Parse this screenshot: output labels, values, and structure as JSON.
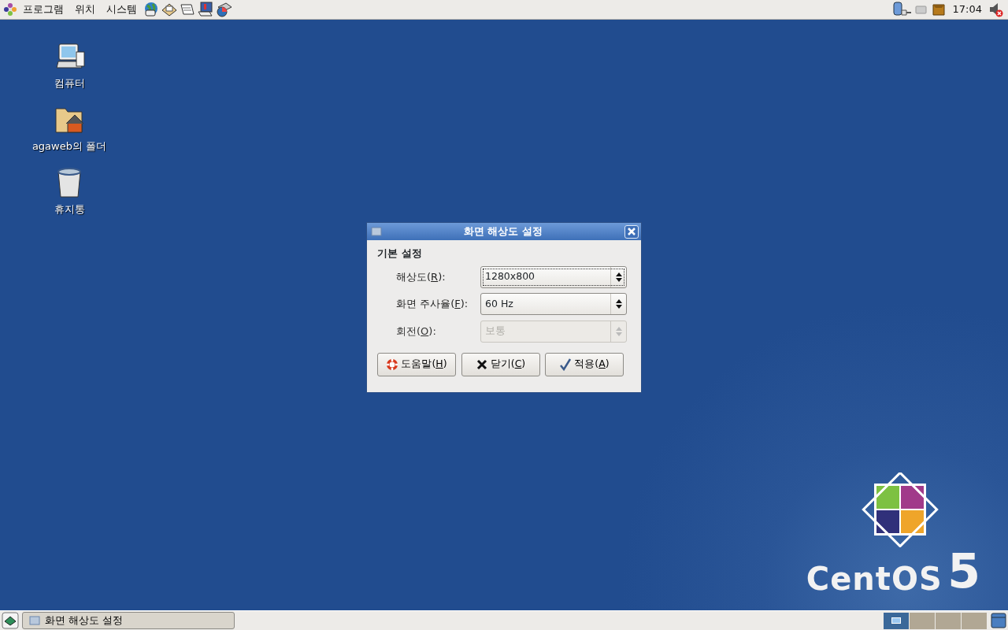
{
  "top_panel": {
    "menus": [
      "프로그램",
      "위치",
      "시스템"
    ],
    "launchers": [
      {
        "kind": "globe"
      },
      {
        "kind": "mail"
      },
      {
        "kind": "notes"
      },
      {
        "kind": "screen"
      },
      {
        "kind": "pie"
      }
    ],
    "clock": "17:04",
    "volume_muted": true
  },
  "desktop_icons": [
    {
      "label": "컴퓨터",
      "kind": "computer"
    },
    {
      "label": "agaweb의 폴더",
      "kind": "home"
    },
    {
      "label": "휴지통",
      "kind": "trash"
    }
  ],
  "dialog": {
    "title": "화면 해상도 설정",
    "section": "기본 설정",
    "fields": [
      {
        "label_before": "해상도(",
        "mnemonic": "R",
        "label_after": "):",
        "value": "1280x800",
        "focused": true,
        "disabled": false
      },
      {
        "label_before": "화면 주사율(",
        "mnemonic": "F",
        "label_after": "):",
        "value": "60 Hz",
        "focused": false,
        "disabled": false
      },
      {
        "label_before": "회전(",
        "mnemonic": "O",
        "label_after": "):",
        "value": "보통",
        "focused": false,
        "disabled": true
      }
    ],
    "buttons": [
      {
        "kind": "help",
        "label_before": "도움말(",
        "mnemonic": "H",
        "label_after": ")"
      },
      {
        "kind": "close",
        "label_before": "닫기(",
        "mnemonic": "C",
        "label_after": ")"
      },
      {
        "kind": "apply",
        "label_before": "적용(",
        "mnemonic": "A",
        "label_after": ")"
      }
    ]
  },
  "logo": {
    "name": "CentOS",
    "version": "5"
  },
  "bottom_panel": {
    "tasks": [
      {
        "label": "화면 해상도 설정"
      }
    ],
    "workspaces": [
      {
        "selected": true
      },
      {
        "selected": false
      },
      {
        "selected": false
      },
      {
        "selected": false
      }
    ]
  }
}
